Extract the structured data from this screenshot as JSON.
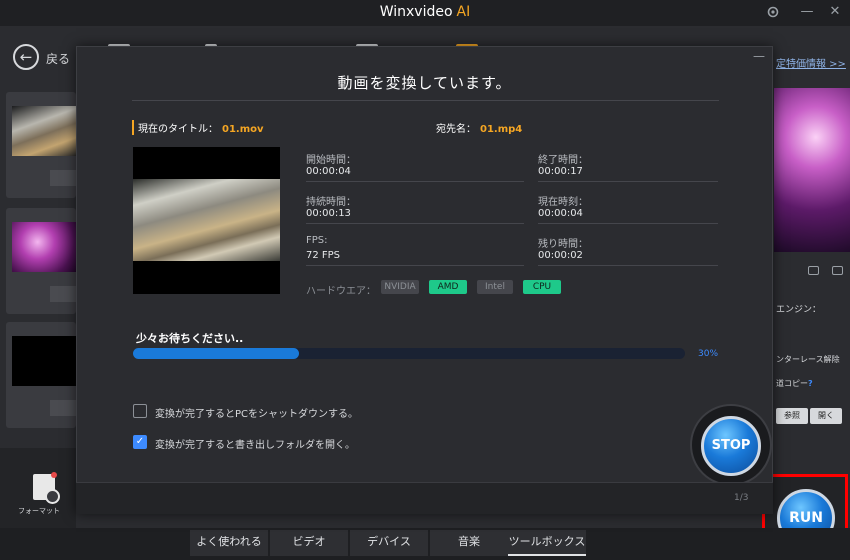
{
  "window": {
    "title": "Winxvideo",
    "title_ai": "AI",
    "settings_icon": "gear-icon",
    "minimize_symbol": "—",
    "close_symbol": "✕"
  },
  "background": {
    "back_label": "戻る",
    "promo_link": "定特価情報 >>",
    "engine_label": "エンジン：",
    "deinterlace_label": "ンターレース解除",
    "copy_label": "道コピー",
    "copy_help": "?",
    "browse_button": "参照",
    "open_button": "開く",
    "format_label": "フォーマット",
    "run_button": "RUN"
  },
  "tabs": [
    {
      "label": "よく使われる"
    },
    {
      "label": "ビデオ"
    },
    {
      "label": "デバイス"
    },
    {
      "label": "音楽"
    },
    {
      "label": "ツールボックス"
    }
  ],
  "modal": {
    "title": "動画を変換しています。",
    "current_title_label": "現在のタイトル：",
    "current_title_value": "01.mov",
    "destination_label": "宛先名：",
    "destination_value": "01.mp4",
    "start_time_label": "開始時間：",
    "start_time_value": "00:00:04",
    "end_time_label": "終了時間：",
    "end_time_value": "00:00:17",
    "duration_label": "持続時間：",
    "duration_value": "00:00:13",
    "current_time_label": "現在時刻：",
    "current_time_value": "00:00:04",
    "fps_label": "FPS:",
    "fps_value": "72 FPS",
    "remaining_label": "残り時間：",
    "remaining_value": "00:00:02",
    "hardware_label": "ハードウエア：",
    "hardware": [
      {
        "label": "NVIDIA",
        "active": false
      },
      {
        "label": "AMD",
        "active": true
      },
      {
        "label": "Intel",
        "active": false
      },
      {
        "label": "CPU",
        "active": true
      }
    ],
    "wait_label": "少々お待ちください..",
    "progress_percent": 30,
    "progress_text": "30%",
    "shutdown_label": "変換が完了するとPCをシャットダウンする。",
    "shutdown_checked": false,
    "open_folder_label": "変換が完了すると書き出しフォルダを開く。",
    "open_folder_checked": true,
    "check_mark": "✓",
    "stop_button": "STOP",
    "page_indicator": "1/3",
    "minimize_symbol": "—"
  },
  "colors": {
    "accent_orange": "#f5a623",
    "progress_blue": "#1a7ad9",
    "hardware_active": "#1ec98a",
    "highlight_red": "#ff0000"
  }
}
